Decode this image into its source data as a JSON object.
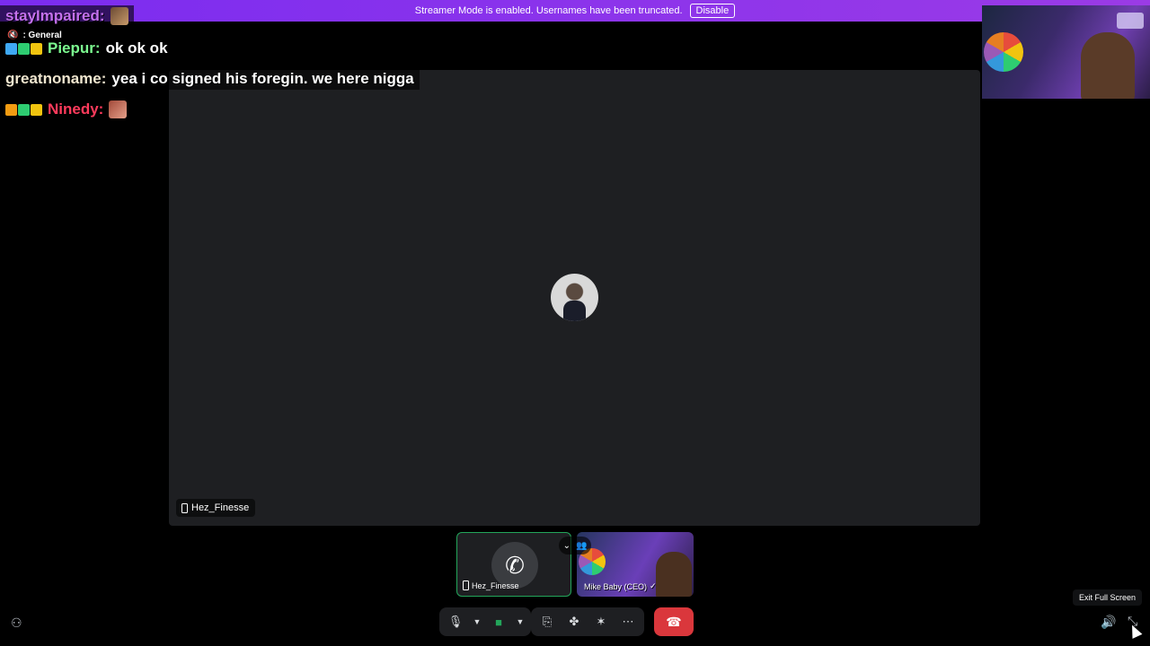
{
  "banner": {
    "text": "Streamer Mode is enabled. Usernames have been truncated.",
    "button": "Disable",
    "color": "#8a2be2"
  },
  "chat": {
    "channel": ": General",
    "messages": [
      {
        "user": "stayImpaired:",
        "text": ""
      },
      {
        "user": "Piepur:",
        "text": "ok ok ok"
      },
      {
        "user": "greatnoname:",
        "text": "yea i co signed his foregin. we here nigga"
      },
      {
        "user": "Ninedy:",
        "text": ""
      }
    ]
  },
  "stage": {
    "participant_name": "Hez_Finesse",
    "background": "#1e1f22"
  },
  "tiles": [
    {
      "name": "Hez_Finesse",
      "icon": "phone-call-icon"
    },
    {
      "name": "Mike Baby (CEO)",
      "icon": "checkmark-icon"
    }
  ],
  "controls": {
    "mic": "microphone-icon",
    "camera": "camera-icon",
    "screenshare": "screen-share-icon",
    "activities": "activities-icon",
    "soundboard": "soundboard-icon",
    "more": "more-icon",
    "hangup": "hang-up-icon",
    "hangup_color": "#da373c",
    "accent_green": "#23a55a"
  },
  "tooltip": {
    "text": "Exit Full Screen"
  }
}
